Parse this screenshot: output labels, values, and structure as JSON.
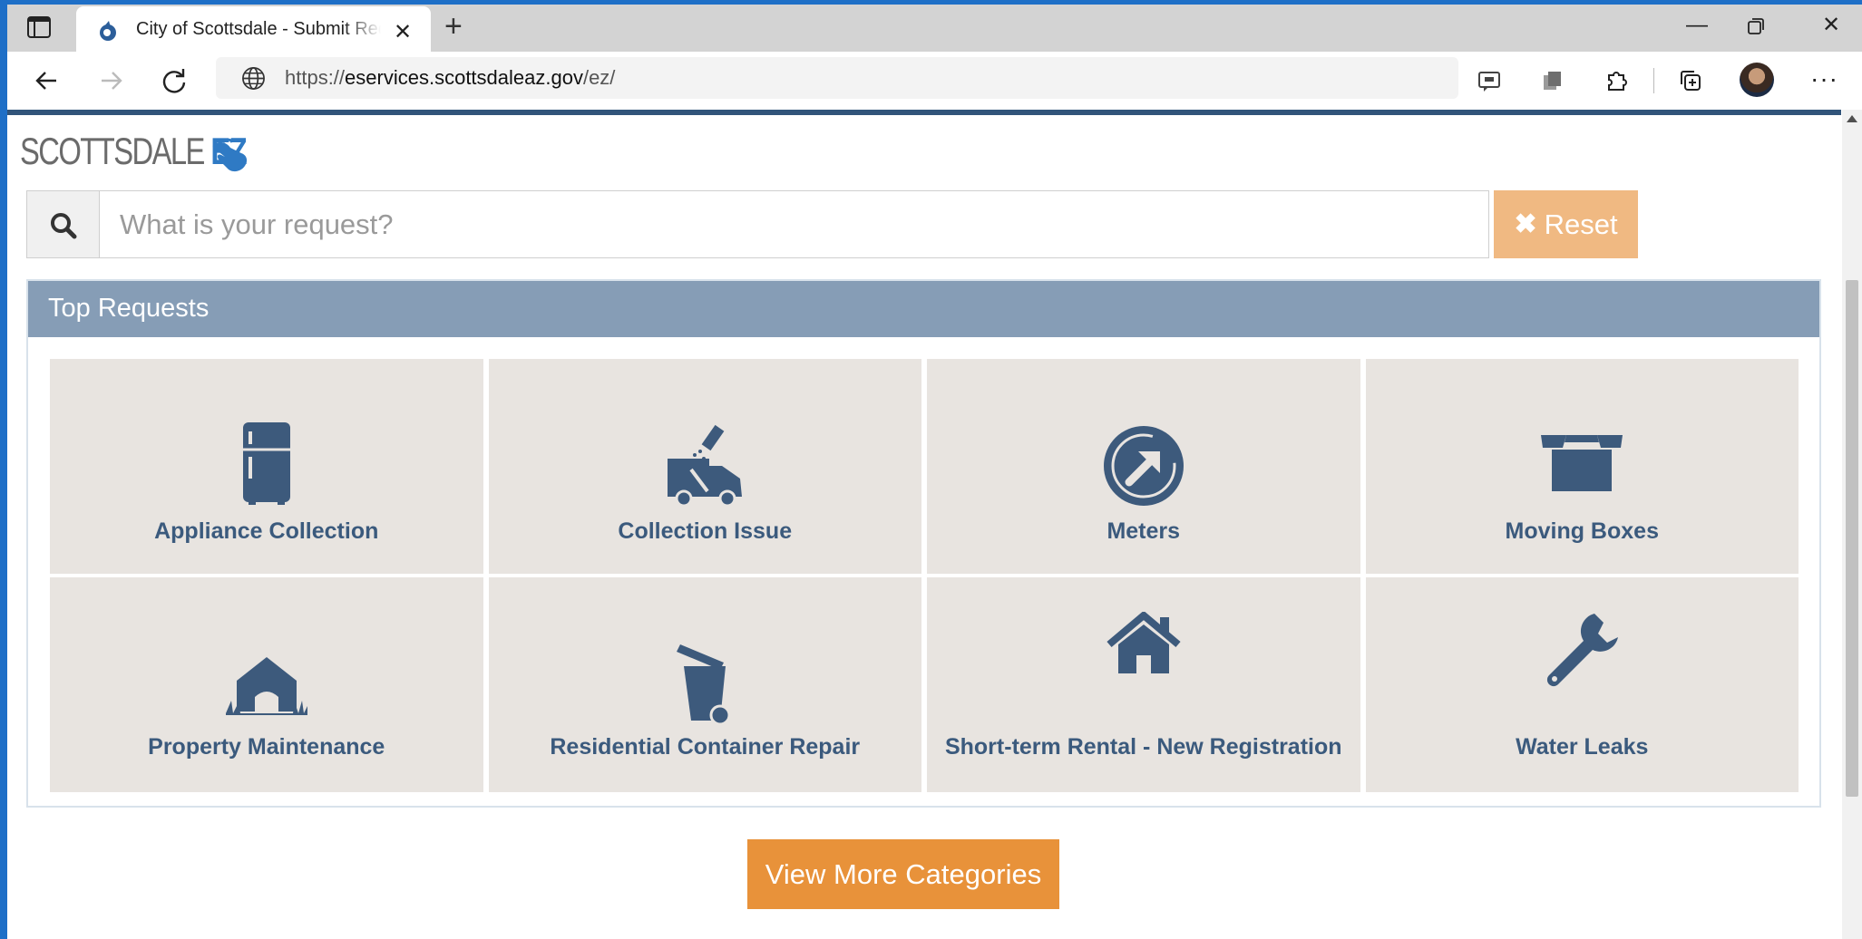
{
  "browser": {
    "tab_title": "City of Scottsdale - Submit Request",
    "url_prefix": "https://",
    "url_host": "eservices.scottsdaleaz.gov",
    "url_path": "/ez/",
    "icons": [
      "sidebar-icon",
      "favicon-icon",
      "close-icon",
      "plus-icon",
      "minimize-icon",
      "restore-icon",
      "close-window-icon",
      "back-icon",
      "forward-icon",
      "refresh-icon",
      "globe-icon",
      "feedback-icon",
      "collections-icon",
      "extensions-icon",
      "favorites-icon",
      "profile-avatar",
      "more-icon"
    ]
  },
  "logo": {
    "text": "SCOTTSDALE",
    "ez": "EZ"
  },
  "search": {
    "placeholder": "What is your request?",
    "reset_label": "Reset"
  },
  "panel": {
    "title": "Top Requests"
  },
  "tiles": [
    {
      "label": "Appliance Collection",
      "icon": "refrigerator-icon"
    },
    {
      "label": "Collection Issue",
      "icon": "collection-truck-icon"
    },
    {
      "label": "Meters",
      "icon": "meter-arrow-icon"
    },
    {
      "label": "Moving Boxes",
      "icon": "open-box-icon"
    },
    {
      "label": "Property Maintenance",
      "icon": "shed-grass-icon"
    },
    {
      "label": "Residential Container Repair",
      "icon": "trash-bin-icon"
    },
    {
      "label": "Short-term Rental - New Registration",
      "icon": "house-icon"
    },
    {
      "label": "Water Leaks",
      "icon": "wrench-icon"
    }
  ],
  "more_button": "View More Categories",
  "colors": {
    "header_bar": "#869db6",
    "tile_bg": "#e8e4e0",
    "tile_text": "#3b5a7d",
    "reset_btn": "#f0b982",
    "more_btn": "#e8923a",
    "top_line": "#31547a"
  }
}
